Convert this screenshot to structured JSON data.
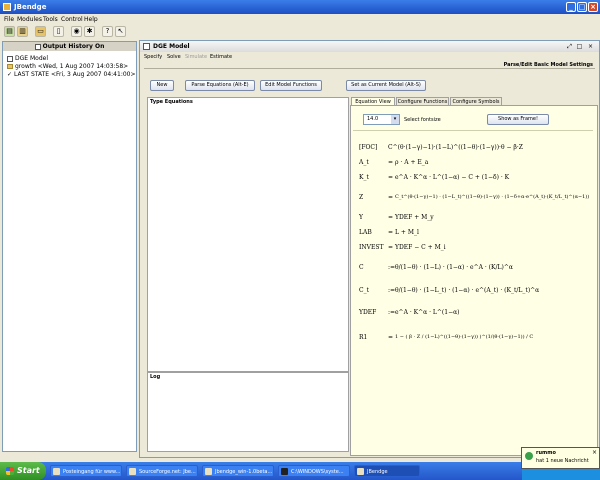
{
  "window": {
    "title": "JBendge"
  },
  "menubar": [
    "File",
    "Modules",
    "Tools",
    "Control",
    "Help"
  ],
  "toolbar_icons": [
    "new-icon",
    "open-icon",
    "folder-icon",
    "trash-icon",
    "target-icon",
    "gear-icon",
    "help-icon",
    "whatsthis-icon"
  ],
  "left_panel": {
    "title": "Output History On",
    "items": [
      {
        "label": "DGE Model",
        "icon": "checkbox"
      },
      {
        "label": "growth <Wed, 1 Aug 2007 14:03:58>",
        "icon": "folder"
      },
      {
        "label": "LAST STATE <Fri, 3 Aug 2007 04:41:00>",
        "icon": "check"
      }
    ]
  },
  "dge": {
    "title": "DGE Model",
    "menu": [
      {
        "label": "Specify",
        "enabled": true
      },
      {
        "label": "Solve",
        "enabled": true
      },
      {
        "label": "Simulate",
        "enabled": false
      },
      {
        "label": "Estimate",
        "enabled": true
      }
    ],
    "section_label": "Parse/Edit Basic Model Settings",
    "buttons": {
      "new": "New",
      "parse": "Parse Equations (Alt-E)",
      "edit": "Edit Model Functions",
      "set_current": "Set as Current Model (Alt-S)"
    },
    "type_equations_label": "Type Equations",
    "log_label": "Log",
    "tabs": [
      "Equation View",
      "Configure Functions",
      "Configure Symbols"
    ],
    "font_size": "14.0",
    "font_size_label": "Select fontsize",
    "show_frame": "Show as Frame!",
    "equations": [
      {
        "lhs": "[FOC]",
        "rel": "",
        "rhs": "C^(θ·(1−γ)−1)·(1−L)^((1−θ)·(1−γ))·θ − β·Z"
      },
      {
        "lhs": "A_t",
        "rel": "=",
        "rhs": "ρ · A + E_a"
      },
      {
        "lhs": "K_t",
        "rel": "=",
        "rhs": "e^A · K^α · L^(1−α) − C + (1−δ) · K"
      },
      {
        "lhs": "Z",
        "rel": "=",
        "rhs": "C_t^(θ·(1−γ)−1) · (1−L_t)^((1−θ)·(1−γ)) · (1−δ+α·e^(A_t)·(K_t/L_t)^(α−1))"
      },
      {
        "lhs": "Y",
        "rel": "=",
        "rhs": "YDEF + M_y"
      },
      {
        "lhs": "LAB",
        "rel": "=",
        "rhs": "L + M_l"
      },
      {
        "lhs": "INVEST",
        "rel": "=",
        "rhs": "YDEF − C + M_i"
      },
      {
        "lhs": "C",
        "rel": ":=",
        "rhs": "θ/(1−θ) · (1−L) · (1−α) · e^A · (K/L)^α"
      },
      {
        "lhs": "C_t",
        "rel": ":=",
        "rhs": "θ/(1−θ) · (1−L_t) · (1−α) · e^(A_t) · (K_t/L_t)^α"
      },
      {
        "lhs": "YDEF",
        "rel": ":=",
        "rhs": "e^A · K^α · L^(1−α)"
      },
      {
        "lhs": "R1",
        "rel": "=",
        "rhs": "1 − ( β · Z / (1−L)^((1−θ)·(1−γ)) )^(1/(θ·(1−γ)−1)) / C"
      }
    ]
  },
  "taskbar": {
    "start": "Start",
    "tasks": [
      "Posteingang für www...",
      "SourceForge.net: Jbe...",
      "Jbendge_win-1.0beta...",
      "C:\\WINDOWS\\syste...",
      "JBendge"
    ]
  },
  "notification": {
    "name": "rummo",
    "text": "hat 1 neue Nachricht"
  }
}
